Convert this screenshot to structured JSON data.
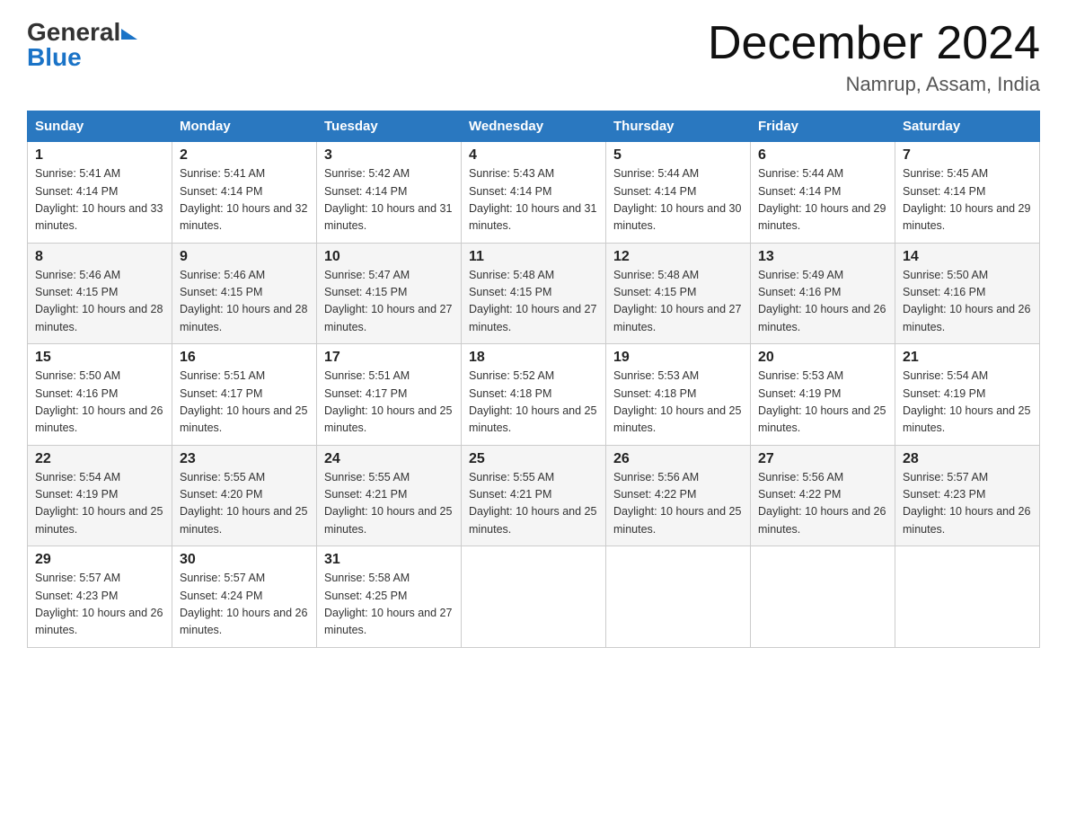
{
  "header": {
    "logo_general": "General",
    "logo_blue": "Blue",
    "month_title": "December 2024",
    "location": "Namrup, Assam, India"
  },
  "days_of_week": [
    "Sunday",
    "Monday",
    "Tuesday",
    "Wednesday",
    "Thursday",
    "Friday",
    "Saturday"
  ],
  "weeks": [
    [
      {
        "day": "1",
        "sunrise": "5:41 AM",
        "sunset": "4:14 PM",
        "daylight": "10 hours and 33 minutes."
      },
      {
        "day": "2",
        "sunrise": "5:41 AM",
        "sunset": "4:14 PM",
        "daylight": "10 hours and 32 minutes."
      },
      {
        "day": "3",
        "sunrise": "5:42 AM",
        "sunset": "4:14 PM",
        "daylight": "10 hours and 31 minutes."
      },
      {
        "day": "4",
        "sunrise": "5:43 AM",
        "sunset": "4:14 PM",
        "daylight": "10 hours and 31 minutes."
      },
      {
        "day": "5",
        "sunrise": "5:44 AM",
        "sunset": "4:14 PM",
        "daylight": "10 hours and 30 minutes."
      },
      {
        "day": "6",
        "sunrise": "5:44 AM",
        "sunset": "4:14 PM",
        "daylight": "10 hours and 29 minutes."
      },
      {
        "day": "7",
        "sunrise": "5:45 AM",
        "sunset": "4:14 PM",
        "daylight": "10 hours and 29 minutes."
      }
    ],
    [
      {
        "day": "8",
        "sunrise": "5:46 AM",
        "sunset": "4:15 PM",
        "daylight": "10 hours and 28 minutes."
      },
      {
        "day": "9",
        "sunrise": "5:46 AM",
        "sunset": "4:15 PM",
        "daylight": "10 hours and 28 minutes."
      },
      {
        "day": "10",
        "sunrise": "5:47 AM",
        "sunset": "4:15 PM",
        "daylight": "10 hours and 27 minutes."
      },
      {
        "day": "11",
        "sunrise": "5:48 AM",
        "sunset": "4:15 PM",
        "daylight": "10 hours and 27 minutes."
      },
      {
        "day": "12",
        "sunrise": "5:48 AM",
        "sunset": "4:15 PM",
        "daylight": "10 hours and 27 minutes."
      },
      {
        "day": "13",
        "sunrise": "5:49 AM",
        "sunset": "4:16 PM",
        "daylight": "10 hours and 26 minutes."
      },
      {
        "day": "14",
        "sunrise": "5:50 AM",
        "sunset": "4:16 PM",
        "daylight": "10 hours and 26 minutes."
      }
    ],
    [
      {
        "day": "15",
        "sunrise": "5:50 AM",
        "sunset": "4:16 PM",
        "daylight": "10 hours and 26 minutes."
      },
      {
        "day": "16",
        "sunrise": "5:51 AM",
        "sunset": "4:17 PM",
        "daylight": "10 hours and 25 minutes."
      },
      {
        "day": "17",
        "sunrise": "5:51 AM",
        "sunset": "4:17 PM",
        "daylight": "10 hours and 25 minutes."
      },
      {
        "day": "18",
        "sunrise": "5:52 AM",
        "sunset": "4:18 PM",
        "daylight": "10 hours and 25 minutes."
      },
      {
        "day": "19",
        "sunrise": "5:53 AM",
        "sunset": "4:18 PM",
        "daylight": "10 hours and 25 minutes."
      },
      {
        "day": "20",
        "sunrise": "5:53 AM",
        "sunset": "4:19 PM",
        "daylight": "10 hours and 25 minutes."
      },
      {
        "day": "21",
        "sunrise": "5:54 AM",
        "sunset": "4:19 PM",
        "daylight": "10 hours and 25 minutes."
      }
    ],
    [
      {
        "day": "22",
        "sunrise": "5:54 AM",
        "sunset": "4:19 PM",
        "daylight": "10 hours and 25 minutes."
      },
      {
        "day": "23",
        "sunrise": "5:55 AM",
        "sunset": "4:20 PM",
        "daylight": "10 hours and 25 minutes."
      },
      {
        "day": "24",
        "sunrise": "5:55 AM",
        "sunset": "4:21 PM",
        "daylight": "10 hours and 25 minutes."
      },
      {
        "day": "25",
        "sunrise": "5:55 AM",
        "sunset": "4:21 PM",
        "daylight": "10 hours and 25 minutes."
      },
      {
        "day": "26",
        "sunrise": "5:56 AM",
        "sunset": "4:22 PM",
        "daylight": "10 hours and 25 minutes."
      },
      {
        "day": "27",
        "sunrise": "5:56 AM",
        "sunset": "4:22 PM",
        "daylight": "10 hours and 26 minutes."
      },
      {
        "day": "28",
        "sunrise": "5:57 AM",
        "sunset": "4:23 PM",
        "daylight": "10 hours and 26 minutes."
      }
    ],
    [
      {
        "day": "29",
        "sunrise": "5:57 AM",
        "sunset": "4:23 PM",
        "daylight": "10 hours and 26 minutes."
      },
      {
        "day": "30",
        "sunrise": "5:57 AM",
        "sunset": "4:24 PM",
        "daylight": "10 hours and 26 minutes."
      },
      {
        "day": "31",
        "sunrise": "5:58 AM",
        "sunset": "4:25 PM",
        "daylight": "10 hours and 27 minutes."
      },
      null,
      null,
      null,
      null
    ]
  ],
  "labels": {
    "sunrise_prefix": "Sunrise: ",
    "sunset_prefix": "Sunset: ",
    "daylight_prefix": "Daylight: "
  }
}
